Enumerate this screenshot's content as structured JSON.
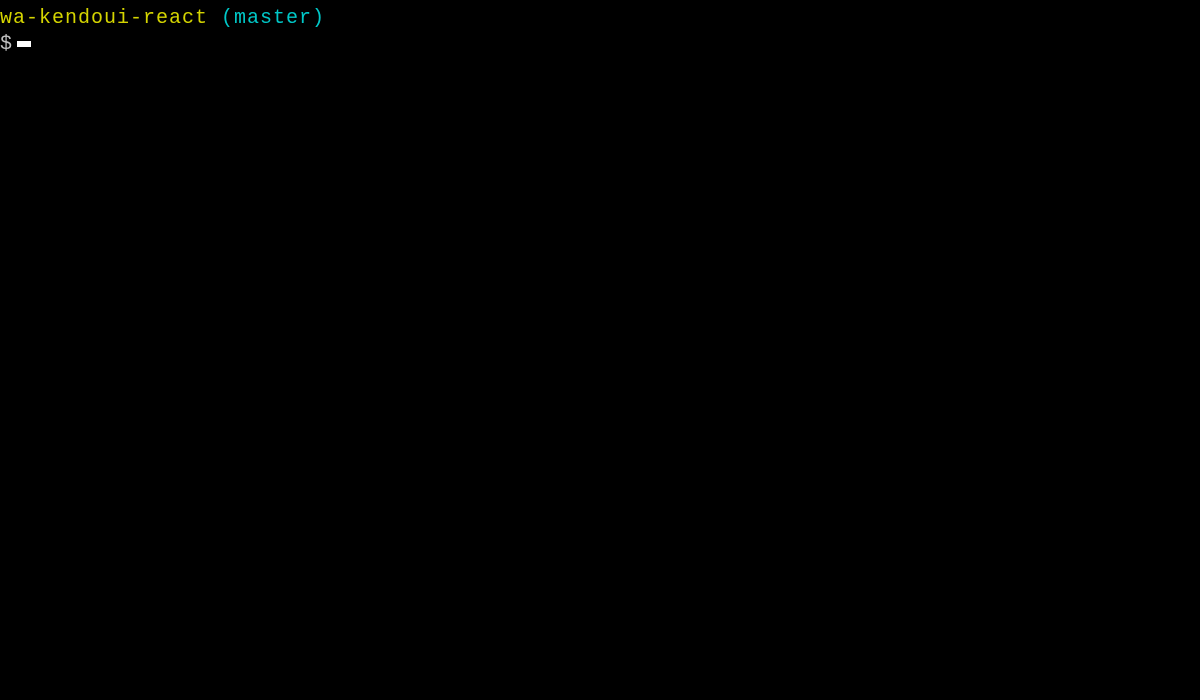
{
  "terminal": {
    "line1": {
      "path": "wa-kendoui-react ",
      "branch": "(master)"
    },
    "line2": {
      "prompt": "$"
    }
  }
}
